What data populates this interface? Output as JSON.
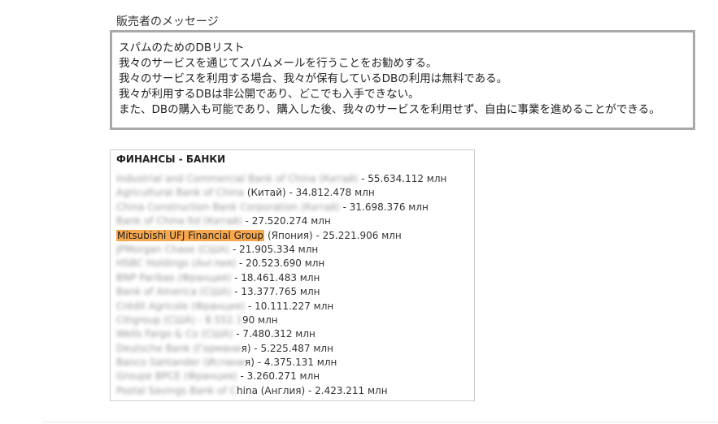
{
  "seller_message_title": "販売者のメッセージ",
  "message_lines": [
    "スパムのためのDBリスト",
    "我々のサービスを通じてスパムメールを行うことをお勧めする。",
    "我々のサービスを利用する場合、我々が保有しているDBの利用は無料である。",
    "我々が利用するDBは非公開であり、どこでも入手できない。",
    "また、DBの購入も可能であり、購入した後、我々のサービスを利用せず、自由に事業を進めることができる。"
  ],
  "bank_list": {
    "header": "ФИНАНСЫ - БАНКИ",
    "rows": [
      {
        "blurred": "Industrial and Commercial Bank of China (Китай)",
        "visible": " - 55.634.112 млн"
      },
      {
        "blurred": "Agricultural Bank of China",
        "visible": " (Китай) - 34.812.478 млн"
      },
      {
        "blurred": "China Construction Bank Corporation (Китай)",
        "visible": " - 31.698.376 млн"
      },
      {
        "blurred": "Bank of China ltd (Китай)",
        "visible": " - 27.520.274 млн"
      },
      {
        "highlight": "Mitsubishi UFJ Financial Group",
        "visible": " (Япония) - 25.221.906 млн"
      },
      {
        "blurred": "JPMorgan Chase (США)",
        "visible": " - 21.905.334 млн"
      },
      {
        "blurred": "HSBC Holdings (Англия)",
        "visible": " - 20.523.690 млн"
      },
      {
        "blurred": "BNP Paribas (Франция)",
        "visible": " - 18.461.483 млн"
      },
      {
        "blurred": "Bank of America (США)",
        "visible": " - 13.377.765 млн"
      },
      {
        "blurred": "Crédit Agricole (Франция)",
        "visible": " - 10.111.227 млн"
      },
      {
        "blurred": "Citigroup (США) - 8.552.1",
        "visible": "90 млн"
      },
      {
        "blurred": "Wells Fargo & Co (США)",
        "visible": " - 7.480.312 млн"
      },
      {
        "blurred": "Deutsche Bank (Германи",
        "visible": "я) - 5.225.487 млн"
      },
      {
        "blurred": "Banco Santander (Испани",
        "visible": "я) - 4.375.131 млн"
      },
      {
        "blurred": "Groupe BPCE (Франция)",
        "visible": " - 3.260.271 млн"
      },
      {
        "blurred": "Postal Savings Bank of C",
        "visible": "hina (Англия) - 2.423.211 млн"
      }
    ]
  }
}
